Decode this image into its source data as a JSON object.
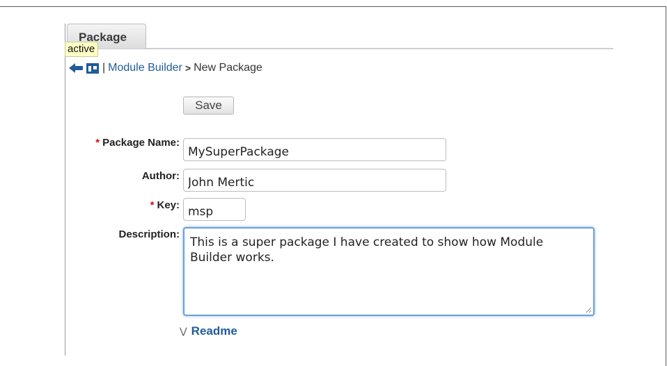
{
  "tab": {
    "label": "Package"
  },
  "tooltip": {
    "text": "active"
  },
  "breadcrumb": {
    "separator": "|",
    "link": "Module Builder",
    "arrow": ">",
    "current": "New Package"
  },
  "toolbar": {
    "save_label": "Save"
  },
  "form": {
    "required_mark": "*",
    "package_name": {
      "label": "Package Name:",
      "value": "MySuperPackage"
    },
    "author": {
      "label": "Author:",
      "value": "John Mertic"
    },
    "key": {
      "label": "Key:",
      "value": "msp"
    },
    "description": {
      "label": "Description:",
      "value": "This is a super package I have created to show how Module Builder works."
    }
  },
  "readme": {
    "label": "Readme",
    "icon": "double-chevron-down-icon"
  },
  "colors": {
    "link": "#1f5c99",
    "required": "#cc1111",
    "focus": "#6a9fd6",
    "tooltip_bg": "#ffffc6"
  }
}
